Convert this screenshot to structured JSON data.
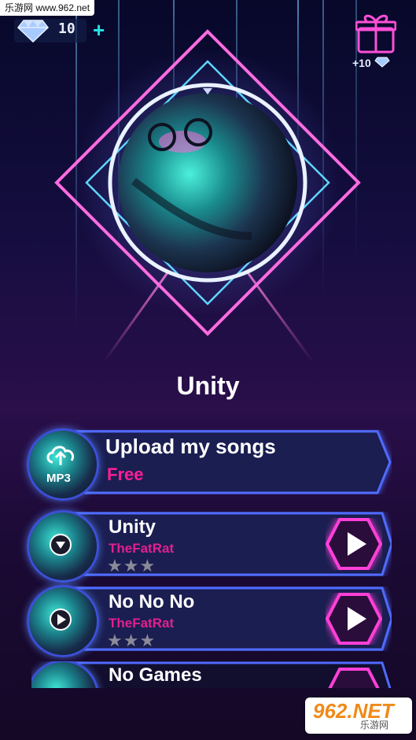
{
  "watermark_top": "乐游网 www.962.net",
  "currency": {
    "icon": "diamond-icon",
    "count": "10",
    "add_label": "+"
  },
  "gift": {
    "icon": "gift-icon",
    "reward": "+10"
  },
  "now_playing": {
    "title": "Unity"
  },
  "upload": {
    "title": "Upload my songs",
    "price": "Free",
    "badge": "MP3"
  },
  "songs": [
    {
      "title": "Unity",
      "artist": "TheFatRat",
      "stars": "★★★"
    },
    {
      "title": "No No No",
      "artist": "TheFatRat",
      "stars": "★★★"
    },
    {
      "title": "No Games",
      "artist": "",
      "stars": ""
    }
  ],
  "watermark_bottom": {
    "brand": "962.NET",
    "sub": "乐游网"
  },
  "colors": {
    "accent_pink": "#ff1e95",
    "accent_cyan": "#27e3e6",
    "frame_blue": "#4f6bff"
  }
}
